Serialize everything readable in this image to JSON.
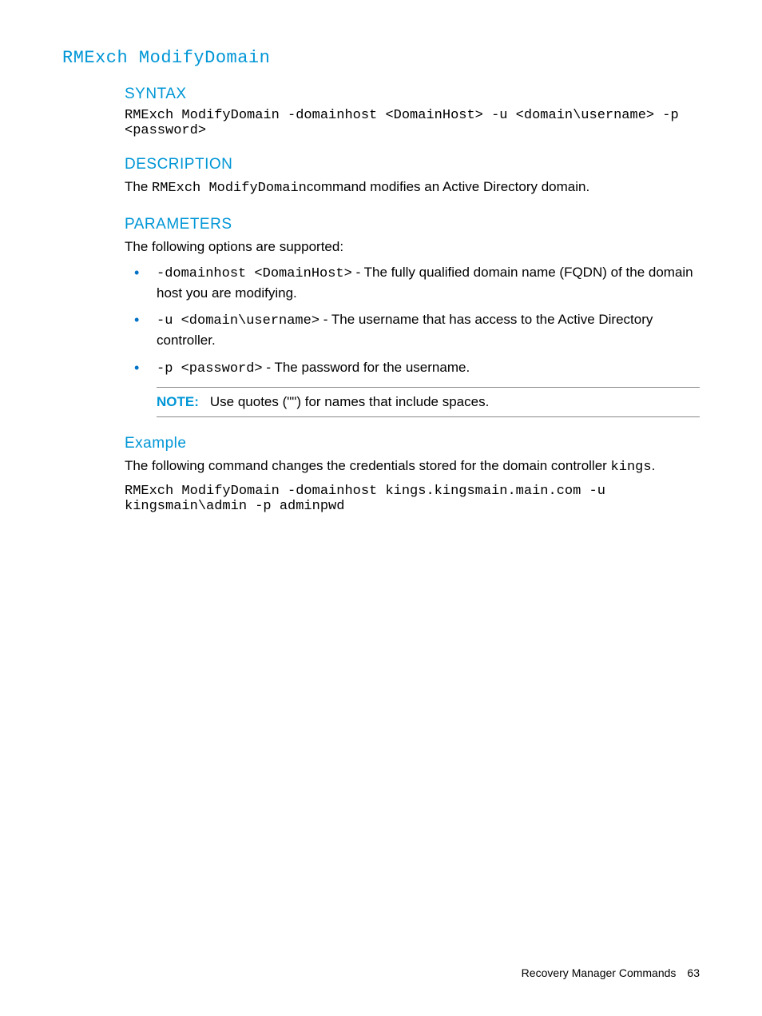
{
  "title": "RMExch ModifyDomain",
  "sections": {
    "syntax": {
      "heading": "Syntax",
      "code": "RMExch ModifyDomain -domainhost <DomainHost> -u <domain\\username> -p <password>"
    },
    "description": {
      "heading": "Description",
      "prefix": "The ",
      "command": "RMExch ModifyDomain",
      "suffix": "command modifies an Active Directory domain."
    },
    "parameters": {
      "heading": "Parameters",
      "intro": "The following options are supported:",
      "items": [
        {
          "code": "-domainhost <DomainHost>",
          "sep": " - ",
          "text": "The fully qualified domain name (FQDN) of the domain host you are modifying."
        },
        {
          "code": "-u <domain\\username>",
          "sep": " - ",
          "text": "The username that has access to the Active Directory controller."
        },
        {
          "code": "-p <password>",
          "sep": " - ",
          "text": "The password for the username."
        }
      ],
      "note": {
        "label": "NOTE:",
        "text": "Use quotes (\"\") for names that include spaces."
      }
    },
    "example": {
      "heading": "Example",
      "intro_prefix": "The following command changes the credentials stored for the domain controller ",
      "intro_code": "kings",
      "intro_suffix": ".",
      "code": "RMExch ModifyDomain -domainhost kings.kingsmain.main.com -u kingsmain\\admin -p adminpwd"
    }
  },
  "footer": {
    "section": "Recovery Manager Commands",
    "page": "63"
  }
}
